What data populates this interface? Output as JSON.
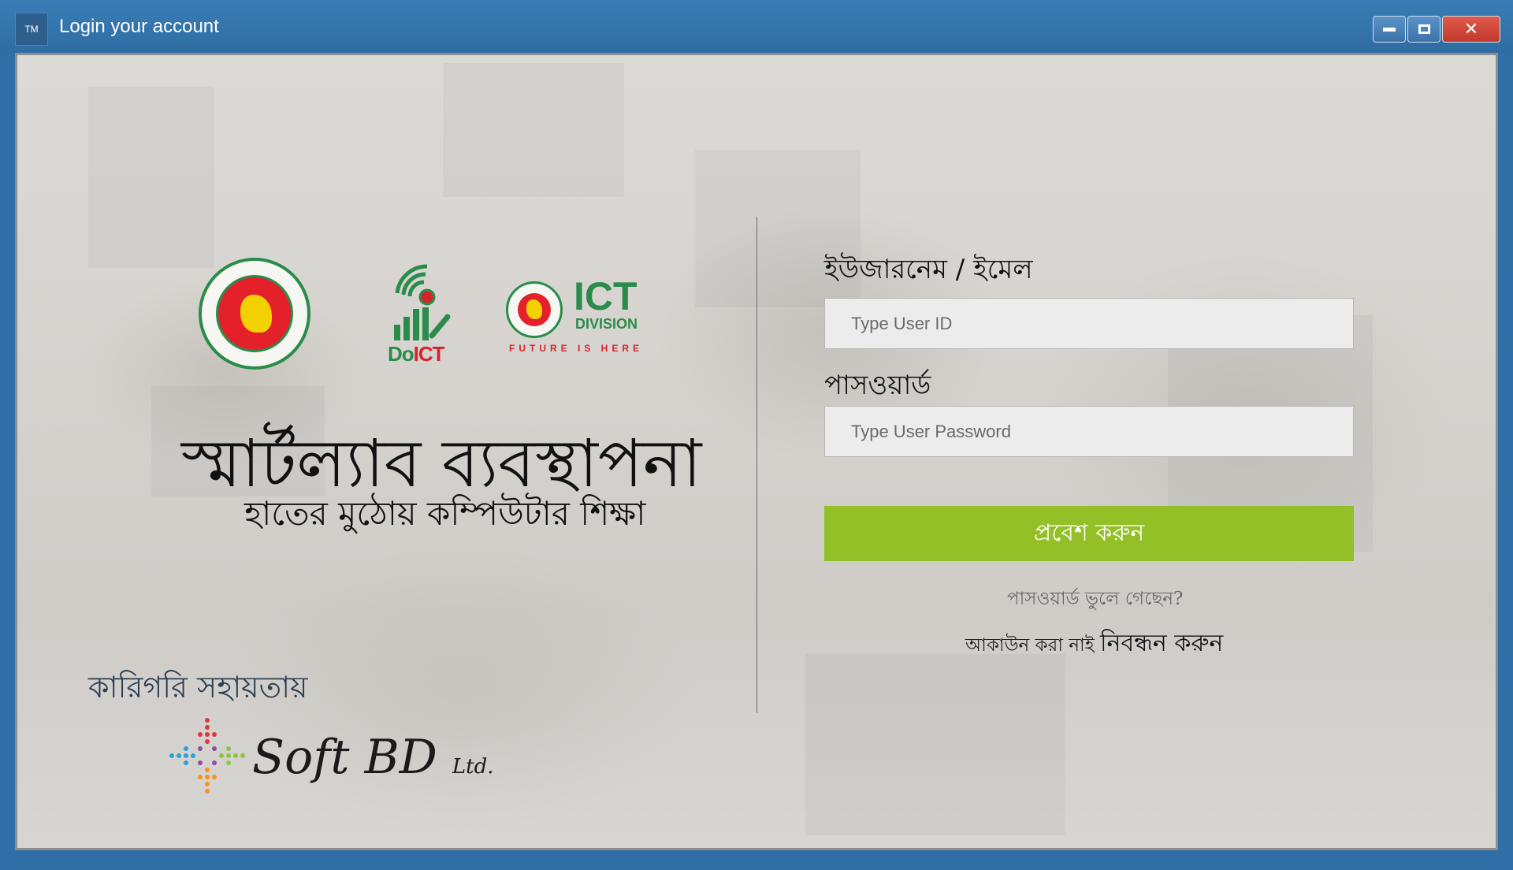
{
  "window": {
    "icon_text": "TM",
    "title": "Login your account"
  },
  "left": {
    "logos": {
      "doict_prefix": "Do",
      "doict_suffix": "ICT",
      "ict_big": "ICT",
      "ict_division": "DIVISION",
      "ict_tagline": "FUTURE IS HERE"
    },
    "headline": "স্মার্টল্যাব ব্যবস্থাপনা",
    "subline": "হাতের মুঠোয় কম্পিউটার শিক্ষা",
    "tech_support_label": "কারিগরি সহায়তায়",
    "softbd": {
      "name": "Soft BD",
      "suffix": "Ltd."
    }
  },
  "form": {
    "username_label": "ইউজারনেম / ইমেল",
    "username_placeholder": "Type User ID",
    "password_label": "পাসওয়ার্ড",
    "password_placeholder": "Type User Password",
    "login_button": "প্রবেশ করুন",
    "forgot_password": "পাসওয়ার্ড ভুলে গেছেন?",
    "no_account_text": "আকাউন করা নাই",
    "register_link": "নিবন্ধন করুন"
  },
  "colors": {
    "titlebar": "#2f6ea6",
    "login_button": "#93c026",
    "brand_green": "#2a8c4a",
    "brand_red": "#d6242b"
  }
}
